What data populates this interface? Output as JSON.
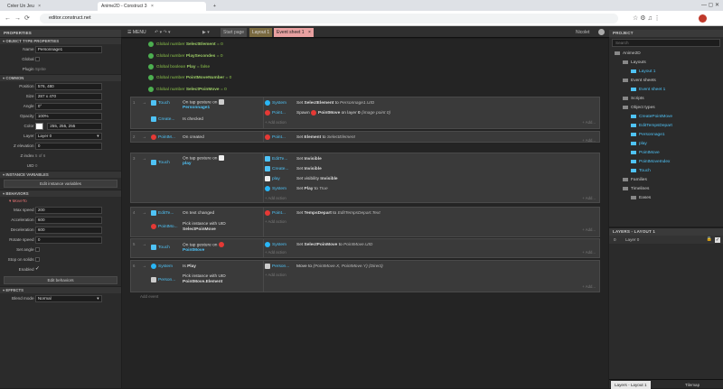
{
  "browser": {
    "tabs": [
      {
        "title": "Créer Un Jeu",
        "close": "×"
      },
      {
        "title": "Anime2D - Construct 3",
        "close": "×"
      }
    ],
    "new_tab": "+",
    "url": "editor.construct.net"
  },
  "app": {
    "menu_label": "MENU",
    "tabs": [
      "Start page",
      "Layout 1",
      "Event sheet 1"
    ],
    "user": "Nicolet",
    "tab_close": "×"
  },
  "properties": {
    "header": "PROPERTIES",
    "object_type_section": "OBJECT TYPE PROPERTIES",
    "name_label": "Name",
    "name_value": "Personnage1",
    "global_label": "Global",
    "plugin_label": "Plugin",
    "plugin_value": "Sprite",
    "common_section": "COMMON",
    "position_label": "Position",
    "position_value": "576, 480",
    "size_label": "Size",
    "size_value": "287 x 470",
    "angle_label": "Angle",
    "angle_value": "0°",
    "opacity_label": "Opacity",
    "opacity_value": "100%",
    "color_label": "Color",
    "color_value": "255, 255, 255",
    "layer_label": "Layer",
    "layer_value": "Layer 0",
    "zelev_label": "Z elevation",
    "zelev_value": "0",
    "zindex_label": "Z index",
    "zindex_value": "5 of 6",
    "uid_label": "UID",
    "uid_value": "0",
    "instance_vars_section": "INSTANCE VARIABLES",
    "edit_instance_vars": "Edit instance variables",
    "behaviors_section": "BEHAVIORS",
    "behavior_name": "MoveTo",
    "maxspeed_label": "Max speed",
    "maxspeed_value": "200",
    "accel_label": "Acceleration",
    "accel_value": "600",
    "decel_label": "Deceleration",
    "decel_value": "600",
    "rotspeed_label": "Rotate speed",
    "rotspeed_value": "0",
    "setangle_label": "Set angle",
    "stopsolids_label": "Stop on solids",
    "enabled_label": "Enabled",
    "enabled_check": "✓",
    "edit_behaviors": "Edit behaviors",
    "effects_section": "EFFECTS",
    "blend_label": "Blend mode",
    "blend_value": "Normal"
  },
  "globals": [
    {
      "kw": "Global number",
      "name": "SelectElement",
      "rest": "= 0"
    },
    {
      "kw": "Global number",
      "name": "PlaySecondes",
      "rest": "= 0"
    },
    {
      "kw": "Global boolean",
      "name": "Play",
      "rest": "= false"
    },
    {
      "kw": "Global number",
      "name": "PointMoveNumber",
      "rest": "= 0"
    },
    {
      "kw": "Global number",
      "name": "SelectPoinMove",
      "rest": "= 0"
    }
  ],
  "events": {
    "e1": {
      "num": "1",
      "c1obj": "Touch",
      "c1txt": "On tap gesture on",
      "c1txt2": "Personnage1",
      "c2obj": "Create...",
      "c2txt": "Is checked",
      "a1obj": "System",
      "a1txt_pre": "Set",
      "a1txt_b": "SelectElement",
      "a1txt_post": "to",
      "a1txt_i": "Personnage1.UID",
      "a2obj": "Point...",
      "a2txt_pre": "Spawn",
      "a2txt_b": "PointMove",
      "a2txt_post": "on layer",
      "a2txt_b2": "0",
      "a2txt_i": "(image point 0)"
    },
    "e2": {
      "num": "2",
      "c1obj": "PointM...",
      "c1txt": "On created",
      "a1obj": "Point...",
      "a1txt_pre": "Set",
      "a1txt_b": "Element",
      "a1txt_post": "to",
      "a1txt_i": "SelectElement"
    },
    "e3": {
      "num": "3",
      "c1obj": "Touch",
      "c1txt": "On tap gesture on",
      "c1txt2": "play",
      "a1obj": "EditTe...",
      "a1txt_pre": "Set",
      "a1txt_b": "Invisible",
      "a2obj": "Create...",
      "a2txt_pre": "Set",
      "a2txt_b": "Invisible",
      "a3obj": "play",
      "a3txt_pre": "Set visibility",
      "a3txt_b": "Invisible",
      "a4obj": "System",
      "a4txt_pre": "Set",
      "a4txt_b": "Play",
      "a4txt_post": "to",
      "a4txt_i": "True"
    },
    "e4": {
      "num": "4",
      "c1obj": "EditTe...",
      "c1txt": "On text changed",
      "c2obj": "PointMo...",
      "c2txt": "Pick instance with UID",
      "c2txt2": "SelectPoinMove",
      "a1obj": "Point...",
      "a1txt_pre": "Set",
      "a1txt_b": "TempsDepart",
      "a1txt_post": "to",
      "a1txt_i": "EditTempsDepart.Text"
    },
    "e5": {
      "num": "5",
      "c1obj": "Touch",
      "c1txt": "On tap gesture on",
      "c1txt2": "PointMove",
      "a1obj": "System",
      "a1txt_pre": "Set",
      "a1txt_b": "SelectPoinMove",
      "a1txt_post": "to",
      "a1txt_i": "PointMove.UID"
    },
    "e6": {
      "num": "6",
      "c1obj": "System",
      "c1txt_pre": "Is",
      "c1txt": "Play",
      "c2obj": "Person...",
      "c2txt": "Pick instance with UID",
      "c2txt2": "PointMove.Element",
      "a1obj": "Person...",
      "a1txt_pre": "Move to",
      "a1txt_i": "(PointMove.X, PointMove.Y) (Direct)"
    },
    "add_action": "+ Add action",
    "add_dots": "+ Add...",
    "add_event": "Add event"
  },
  "project": {
    "header": "PROJECT",
    "search_placeholder": "Search",
    "items": [
      {
        "label": "Anime2D",
        "level": 0
      },
      {
        "label": "Layouts",
        "level": 1
      },
      {
        "label": "Layout 1",
        "level": 2,
        "sel": true
      },
      {
        "label": "Event sheets",
        "level": 1
      },
      {
        "label": "Event sheet 1",
        "level": 2,
        "sel": true
      },
      {
        "label": "Scripts",
        "level": 1
      },
      {
        "label": "Object types",
        "level": 1
      },
      {
        "label": "CreatePointMove",
        "level": 2,
        "sel": true
      },
      {
        "label": "EditTempsDepart",
        "level": 2,
        "sel": true
      },
      {
        "label": "Personnage1",
        "level": 2,
        "sel": true
      },
      {
        "label": "play",
        "level": 2,
        "sel": true
      },
      {
        "label": "PointMove",
        "level": 2,
        "sel": true
      },
      {
        "label": "PointMoveIndex",
        "level": 2,
        "sel": true
      },
      {
        "label": "Touch",
        "level": 2,
        "sel": true
      },
      {
        "label": "Families",
        "level": 1
      },
      {
        "label": "Timelines",
        "level": 1
      },
      {
        "label": "Eases",
        "level": 2
      }
    ]
  },
  "layers": {
    "header": "LAYERS - LAYOUT 1",
    "row_index": "0",
    "row_name": "Layer 0",
    "row_check": "✓"
  },
  "bottom_tabs": [
    "Layers - Layout 1",
    "Tilemap"
  ]
}
